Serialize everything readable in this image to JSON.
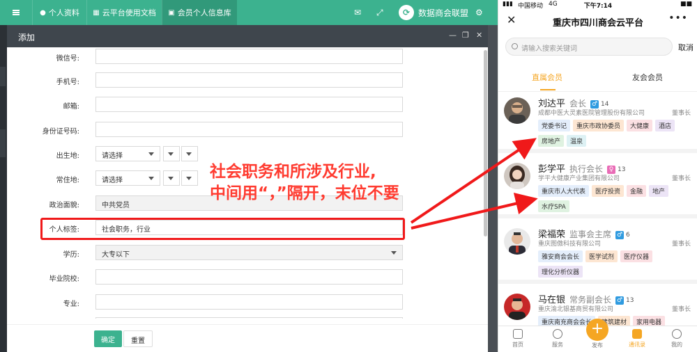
{
  "topbar": {
    "tabs": [
      {
        "icon": "user-icon",
        "label": "个人资料"
      },
      {
        "icon": "document-icon",
        "label": "云平台使用文档"
      },
      {
        "icon": "id-card-icon",
        "label": "会员个人信息库"
      }
    ],
    "brand": "数据商会联盟",
    "accent": "#3cb28f"
  },
  "dialog": {
    "title": "添加",
    "fields": {
      "wechat": {
        "label": "微信号:",
        "value": ""
      },
      "phone": {
        "label": "手机号:",
        "value": ""
      },
      "email": {
        "label": "邮箱:",
        "value": ""
      },
      "idcard": {
        "label": "身份证号码:",
        "value": ""
      },
      "birthplace": {
        "label": "出生地:",
        "value": "请选择"
      },
      "residence": {
        "label": "常住地:",
        "value": "请选择"
      },
      "political": {
        "label": "政治面貌:",
        "value": "中共党员"
      },
      "tags": {
        "label": "个人标签:",
        "value": "社会职务，行业"
      },
      "education": {
        "label": "学历:",
        "value": "大专以下"
      },
      "school": {
        "label": "毕业院校:",
        "value": ""
      },
      "major": {
        "label": "专业:",
        "value": ""
      }
    },
    "confirm_label": "确定",
    "reset_label": "重置"
  },
  "annotation": {
    "line1": "社会职务和所涉及行业,",
    "line2": "中间用“，”隔开，末位不要",
    "color": "#ff3b30"
  },
  "phone": {
    "status": {
      "carrier": "中国移动",
      "network": "4G",
      "time": "下午7:14"
    },
    "title": "重庆市四川商会云平台",
    "search_placeholder": "请输入搜索关键词",
    "cancel_label": "取消",
    "tabs": [
      "直属会员",
      "友会会员"
    ],
    "members": [
      {
        "name": "刘达平",
        "role": "会长",
        "gender": "♂",
        "gender_color": "#2f9be0",
        "count": "14",
        "company": "成都中医大灵素医院管理股份有限公司",
        "title": "董事长",
        "tags": [
          "党委书记",
          "重庆市政协委员",
          "大健康",
          "酒店",
          "房地产",
          "温泉"
        ]
      },
      {
        "name": "彭学平",
        "role": "执行会长",
        "gender": "♀",
        "gender_color": "#e96bb6",
        "count": "13",
        "company": "学平大健康产业集团有限公司",
        "title": "董事长",
        "tags": [
          "重庆市人大代表",
          "医疗投资",
          "金融",
          "地产",
          "水疗SPA"
        ]
      },
      {
        "name": "梁福荣",
        "role": "监事会主席",
        "gender": "♂",
        "gender_color": "#2f9be0",
        "count": "6",
        "company": "重庆图傲科技有限公司",
        "title": "董事长",
        "tags": [
          "雅安商会会长",
          "医学试剂",
          "医疗仪器",
          "理化分析仪器"
        ]
      },
      {
        "name": "马在银",
        "role": "常务副会长",
        "gender": "♂",
        "gender_color": "#2f9be0",
        "count": "13",
        "company": "重庆渝北银基商贸有限公司",
        "title": "董事长",
        "tags": [
          "重庆南充商会会长",
          "建筑建材",
          "家用电器"
        ]
      }
    ],
    "tabbar": [
      "首页",
      "服务",
      "发布",
      "通讯录",
      "我的"
    ],
    "accent": "#f5a623"
  }
}
